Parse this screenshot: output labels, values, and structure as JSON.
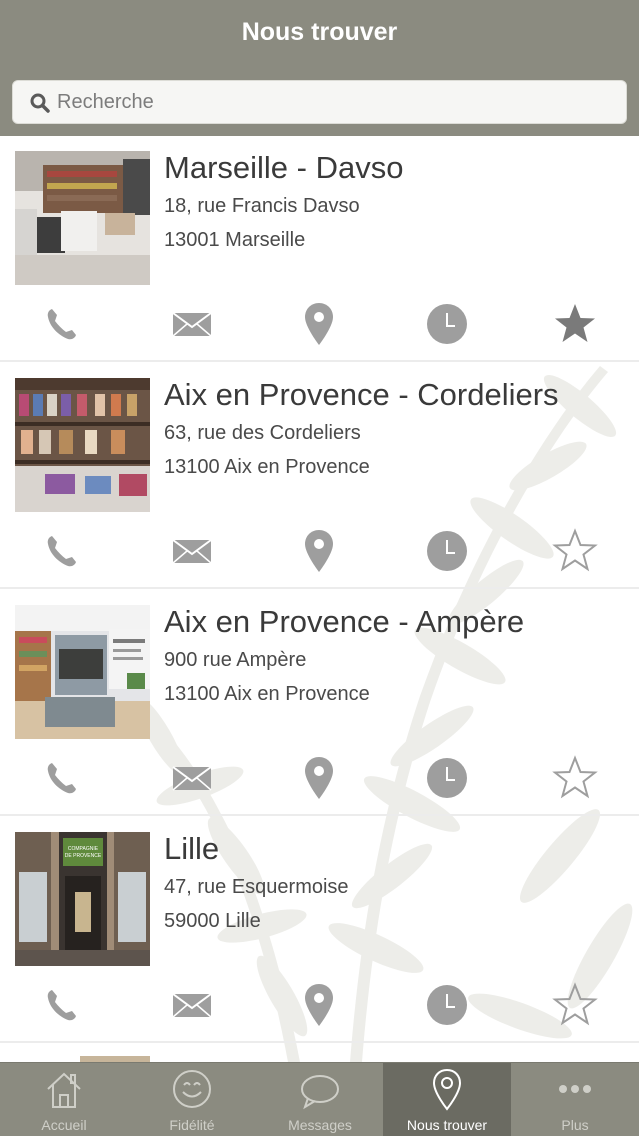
{
  "header": {
    "title": "Nous trouver"
  },
  "search": {
    "placeholder": "Recherche",
    "value": ""
  },
  "stores": [
    {
      "name": "Marseille - Davso",
      "address": "18, rue Francis Davso",
      "city": "13001 Marseille",
      "favorite": true
    },
    {
      "name": "Aix en Provence - Cordeliers",
      "address": "63, rue des Cordeliers",
      "city": "13100 Aix en Provence",
      "favorite": false
    },
    {
      "name": "Aix en Provence - Ampère",
      "address": "900 rue Ampère",
      "city": "13100 Aix en Provence",
      "favorite": false
    },
    {
      "name": "Lille",
      "address": "47, rue Esquermoise",
      "city": "59000 Lille",
      "favorite": false
    }
  ],
  "thumb_texts": {
    "lille_sign": "COMPAGNIE DE PROVENCE"
  },
  "action_icons": [
    "phone-icon",
    "mail-icon",
    "map-pin-icon",
    "clock-icon",
    "star-icon"
  ],
  "tabs": [
    {
      "label": "Accueil",
      "icon": "home-icon",
      "active": false
    },
    {
      "label": "Fidélité",
      "icon": "smiley-icon",
      "active": false
    },
    {
      "label": "Messages",
      "icon": "chat-bubble-icon",
      "active": false
    },
    {
      "label": "Nous trouver",
      "icon": "map-pin-icon",
      "active": true
    },
    {
      "label": "Plus",
      "icon": "more-icon",
      "active": false
    }
  ],
  "colors": {
    "bar": "#8b8b80",
    "bar_active": "#6b6b62",
    "icon_gray": "#9e9e9e"
  }
}
